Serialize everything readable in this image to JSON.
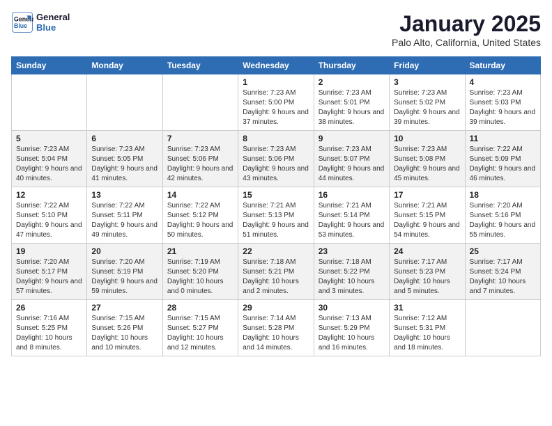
{
  "header": {
    "logo_line1": "General",
    "logo_line2": "Blue",
    "month_title": "January 2025",
    "location": "Palo Alto, California, United States"
  },
  "weekdays": [
    "Sunday",
    "Monday",
    "Tuesday",
    "Wednesday",
    "Thursday",
    "Friday",
    "Saturday"
  ],
  "weeks": [
    [
      {
        "day": "",
        "content": ""
      },
      {
        "day": "",
        "content": ""
      },
      {
        "day": "",
        "content": ""
      },
      {
        "day": "1",
        "content": "Sunrise: 7:23 AM\nSunset: 5:00 PM\nDaylight: 9 hours and 37 minutes."
      },
      {
        "day": "2",
        "content": "Sunrise: 7:23 AM\nSunset: 5:01 PM\nDaylight: 9 hours and 38 minutes."
      },
      {
        "day": "3",
        "content": "Sunrise: 7:23 AM\nSunset: 5:02 PM\nDaylight: 9 hours and 39 minutes."
      },
      {
        "day": "4",
        "content": "Sunrise: 7:23 AM\nSunset: 5:03 PM\nDaylight: 9 hours and 39 minutes."
      }
    ],
    [
      {
        "day": "5",
        "content": "Sunrise: 7:23 AM\nSunset: 5:04 PM\nDaylight: 9 hours and 40 minutes."
      },
      {
        "day": "6",
        "content": "Sunrise: 7:23 AM\nSunset: 5:05 PM\nDaylight: 9 hours and 41 minutes."
      },
      {
        "day": "7",
        "content": "Sunrise: 7:23 AM\nSunset: 5:06 PM\nDaylight: 9 hours and 42 minutes."
      },
      {
        "day": "8",
        "content": "Sunrise: 7:23 AM\nSunset: 5:06 PM\nDaylight: 9 hours and 43 minutes."
      },
      {
        "day": "9",
        "content": "Sunrise: 7:23 AM\nSunset: 5:07 PM\nDaylight: 9 hours and 44 minutes."
      },
      {
        "day": "10",
        "content": "Sunrise: 7:23 AM\nSunset: 5:08 PM\nDaylight: 9 hours and 45 minutes."
      },
      {
        "day": "11",
        "content": "Sunrise: 7:22 AM\nSunset: 5:09 PM\nDaylight: 9 hours and 46 minutes."
      }
    ],
    [
      {
        "day": "12",
        "content": "Sunrise: 7:22 AM\nSunset: 5:10 PM\nDaylight: 9 hours and 47 minutes."
      },
      {
        "day": "13",
        "content": "Sunrise: 7:22 AM\nSunset: 5:11 PM\nDaylight: 9 hours and 49 minutes."
      },
      {
        "day": "14",
        "content": "Sunrise: 7:22 AM\nSunset: 5:12 PM\nDaylight: 9 hours and 50 minutes."
      },
      {
        "day": "15",
        "content": "Sunrise: 7:21 AM\nSunset: 5:13 PM\nDaylight: 9 hours and 51 minutes."
      },
      {
        "day": "16",
        "content": "Sunrise: 7:21 AM\nSunset: 5:14 PM\nDaylight: 9 hours and 53 minutes."
      },
      {
        "day": "17",
        "content": "Sunrise: 7:21 AM\nSunset: 5:15 PM\nDaylight: 9 hours and 54 minutes."
      },
      {
        "day": "18",
        "content": "Sunrise: 7:20 AM\nSunset: 5:16 PM\nDaylight: 9 hours and 55 minutes."
      }
    ],
    [
      {
        "day": "19",
        "content": "Sunrise: 7:20 AM\nSunset: 5:17 PM\nDaylight: 9 hours and 57 minutes."
      },
      {
        "day": "20",
        "content": "Sunrise: 7:20 AM\nSunset: 5:19 PM\nDaylight: 9 hours and 59 minutes."
      },
      {
        "day": "21",
        "content": "Sunrise: 7:19 AM\nSunset: 5:20 PM\nDaylight: 10 hours and 0 minutes."
      },
      {
        "day": "22",
        "content": "Sunrise: 7:18 AM\nSunset: 5:21 PM\nDaylight: 10 hours and 2 minutes."
      },
      {
        "day": "23",
        "content": "Sunrise: 7:18 AM\nSunset: 5:22 PM\nDaylight: 10 hours and 3 minutes."
      },
      {
        "day": "24",
        "content": "Sunrise: 7:17 AM\nSunset: 5:23 PM\nDaylight: 10 hours and 5 minutes."
      },
      {
        "day": "25",
        "content": "Sunrise: 7:17 AM\nSunset: 5:24 PM\nDaylight: 10 hours and 7 minutes."
      }
    ],
    [
      {
        "day": "26",
        "content": "Sunrise: 7:16 AM\nSunset: 5:25 PM\nDaylight: 10 hours and 8 minutes."
      },
      {
        "day": "27",
        "content": "Sunrise: 7:15 AM\nSunset: 5:26 PM\nDaylight: 10 hours and 10 minutes."
      },
      {
        "day": "28",
        "content": "Sunrise: 7:15 AM\nSunset: 5:27 PM\nDaylight: 10 hours and 12 minutes."
      },
      {
        "day": "29",
        "content": "Sunrise: 7:14 AM\nSunset: 5:28 PM\nDaylight: 10 hours and 14 minutes."
      },
      {
        "day": "30",
        "content": "Sunrise: 7:13 AM\nSunset: 5:29 PM\nDaylight: 10 hours and 16 minutes."
      },
      {
        "day": "31",
        "content": "Sunrise: 7:12 AM\nSunset: 5:31 PM\nDaylight: 10 hours and 18 minutes."
      },
      {
        "day": "",
        "content": ""
      }
    ]
  ]
}
